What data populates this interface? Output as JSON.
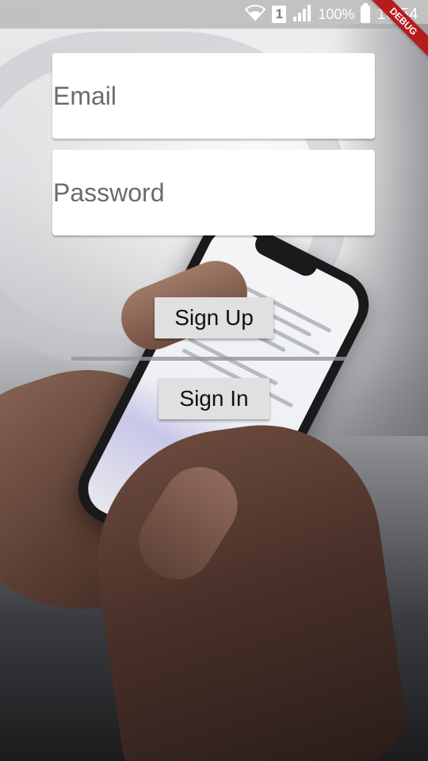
{
  "status_bar": {
    "sim_slot": "1",
    "battery_percent": "100%",
    "time": "18:54",
    "icons": [
      "wifi-icon",
      "sim-icon",
      "signal-icon",
      "battery-icon"
    ]
  },
  "debug_banner": {
    "label": "DEBUG"
  },
  "form": {
    "email": {
      "placeholder": "Email",
      "value": ""
    },
    "password": {
      "placeholder": "Password",
      "value": ""
    },
    "sign_up_label": "Sign Up",
    "sign_in_label": "Sign In"
  },
  "colors": {
    "button_bg": "#e0e0e0",
    "field_bg": "#ffffff",
    "debug_banner": "#b71c1c"
  }
}
